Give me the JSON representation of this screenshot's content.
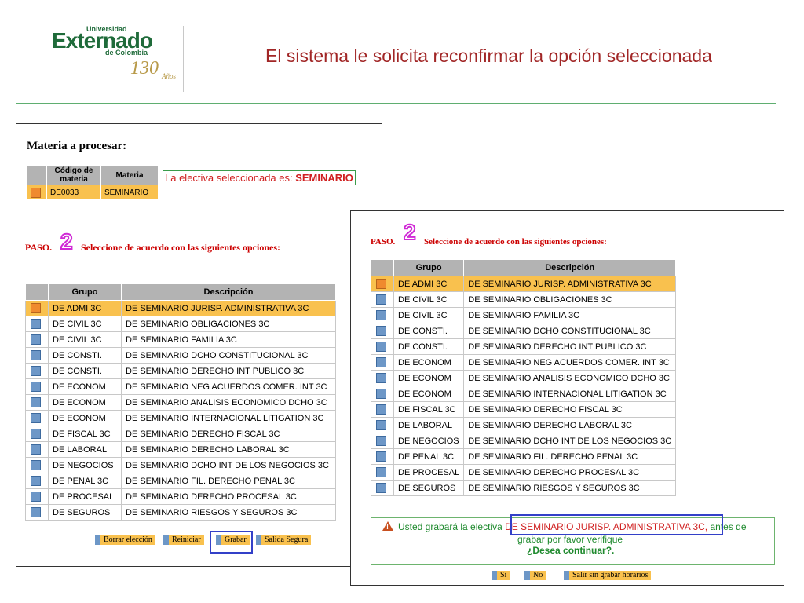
{
  "header": {
    "logo": {
      "universidad": "Universidad",
      "name": "Externado",
      "de_colombia": "de Colombia",
      "anniversary": "130",
      "anos": "Años"
    },
    "title": "El sistema le solicita reconfirmar la opción seleccionada"
  },
  "colors": {
    "title": "#a12626",
    "rule": "#5fae70",
    "selected_row": "#f9c14e",
    "checkbox": "#6d97c7",
    "checkbox_selected": "#ef8a2e",
    "highlight_box": "#3340c8"
  },
  "left_panel": {
    "materia_title": "Materia a procesar:",
    "materia_table": {
      "headers": [
        "Código de materia",
        "Materia"
      ],
      "row": {
        "codigo": "DE0033",
        "materia": "SEMINARIO"
      }
    },
    "electiva_label": "La electiva seleccionada es: ",
    "electiva_value": "SEMINARIO",
    "paso_label": "PASO.",
    "paso_number": "2",
    "paso_instruction": "Seleccione de acuerdo con las siguientes opciones:",
    "buttons": {
      "borrar": "Borrar elección",
      "reiniciar": "Reiniciar",
      "grabar": "Grabar",
      "salida": "Salida Segura"
    }
  },
  "right_panel": {
    "paso_label": "PASO.",
    "paso_number": "2",
    "paso_instruction": "Seleccione de acuerdo con las siguientes opciones:",
    "confirm": {
      "prefix": "Usted grabará la electiva ",
      "selection": "DE SEMINARIO JURISP. ADMINISTRATIVA 3C,",
      "suffix": " antes de",
      "line2": "grabar por favor verifique",
      "question": "¿Desea continuar?."
    },
    "buttons": {
      "si": "Si",
      "no": "No",
      "salir": "Salir sin grabar horarios"
    }
  },
  "options_table": {
    "headers": [
      "Grupo",
      "Descripción"
    ],
    "rows": [
      {
        "grupo": "DE ADMI 3C",
        "descripcion": "DE SEMINARIO JURISP. ADMINISTRATIVA 3C"
      },
      {
        "grupo": "DE CIVIL 3C",
        "descripcion": "DE SEMINARIO OBLIGACIONES 3C"
      },
      {
        "grupo": "DE CIVIL 3C",
        "descripcion": "DE SEMINARIO FAMILIA 3C"
      },
      {
        "grupo": "DE CONSTI.",
        "descripcion": "DE SEMINARIO DCHO CONSTITUCIONAL 3C"
      },
      {
        "grupo": "DE CONSTI.",
        "descripcion": "DE SEMINARIO DERECHO INT PUBLICO 3C"
      },
      {
        "grupo": "DE ECONOM",
        "descripcion": "DE SEMINARIO NEG ACUERDOS COMER. INT 3C"
      },
      {
        "grupo": "DE ECONOM",
        "descripcion": "DE SEMINARIO ANALISIS ECONOMICO DCHO 3C"
      },
      {
        "grupo": "DE ECONOM",
        "descripcion": "DE SEMINARIO INTERNACIONAL LITIGATION 3C"
      },
      {
        "grupo": "DE FISCAL 3C",
        "descripcion": "DE SEMINARIO DERECHO FISCAL 3C"
      },
      {
        "grupo": "DE LABORAL",
        "descripcion": "DE SEMINARIO DERECHO LABORAL 3C"
      },
      {
        "grupo": "DE NEGOCIOS",
        "descripcion": "DE SEMINARIO DCHO INT DE LOS NEGOCIOS 3C"
      },
      {
        "grupo": "DE PENAL 3C",
        "descripcion": "DE SEMINARIO FIL. DERECHO PENAL 3C"
      },
      {
        "grupo": "DE PROCESAL",
        "descripcion": "DE SEMINARIO DERECHO PROCESAL 3C"
      },
      {
        "grupo": "DE SEGUROS",
        "descripcion": "DE SEMINARIO RIESGOS Y SEGUROS 3C"
      }
    ],
    "selected_index": 0
  }
}
